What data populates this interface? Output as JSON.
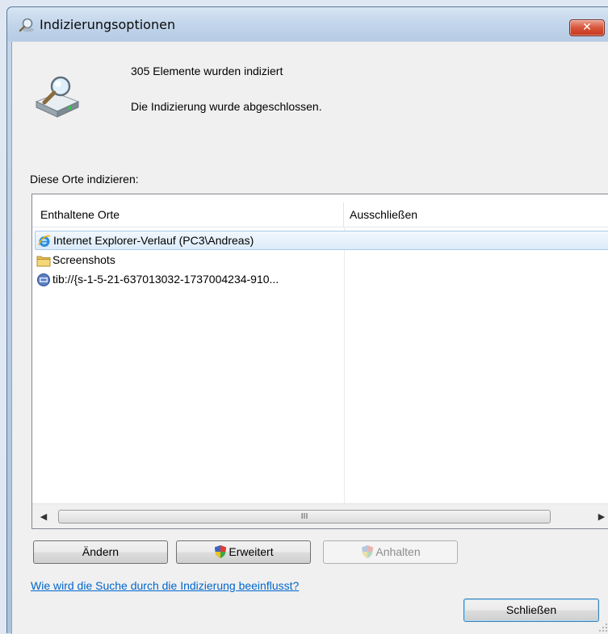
{
  "window": {
    "title": "Indizierungsoptionen",
    "close_label": "✕"
  },
  "status": {
    "items_indexed": "305 Elemente wurden indiziert",
    "indexing_state": "Die Indizierung wurde abgeschlossen."
  },
  "locations": {
    "section_label": "Diese Orte indizieren:",
    "columns": [
      "Enthaltene Orte",
      "Ausschließen"
    ],
    "rows": [
      {
        "name": "Internet Explorer-Verlauf (PC3\\Andreas)",
        "exclude": "",
        "icon": "internet-explorer-icon",
        "selected": true
      },
      {
        "name": "Screenshots",
        "exclude": "",
        "icon": "folder-icon",
        "selected": false
      },
      {
        "name": "tib://{s-1-5-21-637013032-1737004234-910...",
        "exclude": "",
        "icon": "tib-location-icon",
        "selected": false
      }
    ],
    "scrollbar": {
      "left_arrow": "◀",
      "right_arrow": "▶",
      "grip": "III"
    }
  },
  "buttons": {
    "change": "Ändern",
    "advanced": "Erweitert",
    "pause": "Anhalten",
    "close": "Schließen"
  },
  "help_link": "Wie wird die Suche durch die Indizierung beeinflusst?",
  "colors": {
    "link": "#0066cc",
    "selection": "#dcebf9",
    "close_button": "#c5361c"
  }
}
